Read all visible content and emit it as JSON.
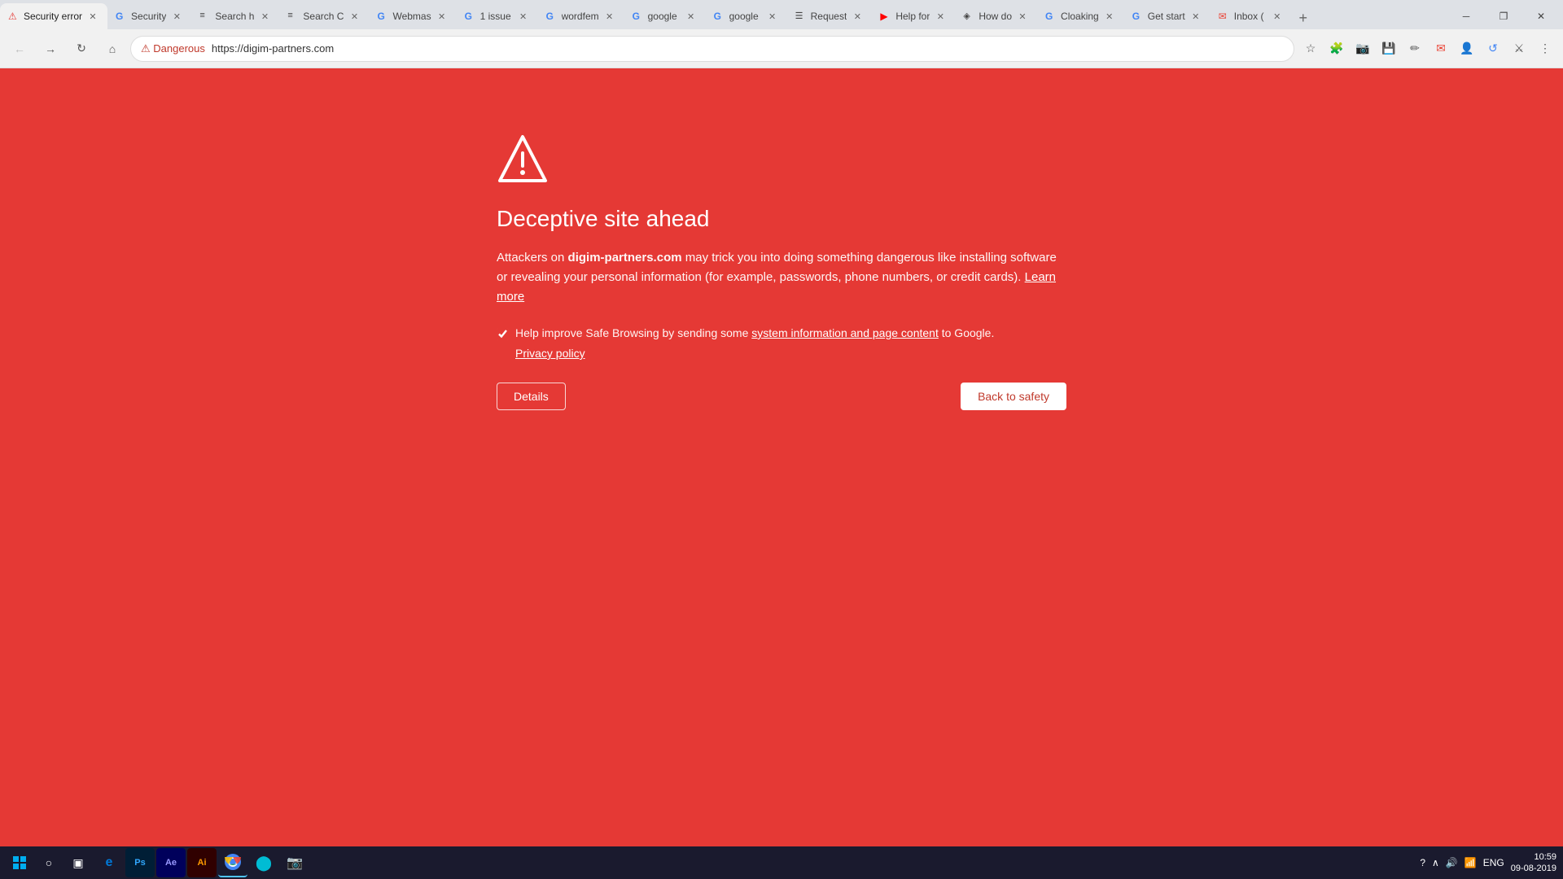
{
  "browser": {
    "tabs": [
      {
        "id": "security-error",
        "label": "Security error",
        "active": true,
        "favicon": "⚠"
      },
      {
        "id": "security",
        "label": "Security",
        "active": false,
        "favicon": "G"
      },
      {
        "id": "search-h",
        "label": "Search h",
        "active": false,
        "favicon": "≡"
      },
      {
        "id": "search-c",
        "label": "Search C",
        "active": false,
        "favicon": "≡"
      },
      {
        "id": "webmaster",
        "label": "Webmas",
        "active": false,
        "favicon": "G"
      },
      {
        "id": "1-issue",
        "label": "1 issue",
        "active": false,
        "favicon": "G"
      },
      {
        "id": "wordfence",
        "label": "wordfem",
        "active": false,
        "favicon": "G"
      },
      {
        "id": "google1",
        "label": "google",
        "active": false,
        "favicon": "G"
      },
      {
        "id": "google2",
        "label": "google",
        "active": false,
        "favicon": "G"
      },
      {
        "id": "request",
        "label": "Request",
        "active": false,
        "favicon": "☰"
      },
      {
        "id": "help-for",
        "label": "Help for",
        "active": false,
        "favicon": "▶"
      },
      {
        "id": "how-do",
        "label": "How do",
        "active": false,
        "favicon": "◈"
      },
      {
        "id": "cloaking",
        "label": "Cloaking",
        "active": false,
        "favicon": "G"
      },
      {
        "id": "get-start",
        "label": "Get start",
        "active": false,
        "favicon": "G"
      },
      {
        "id": "inbox",
        "label": "Inbox (",
        "active": false,
        "favicon": "✉"
      }
    ],
    "url": "https://digim-partners.com",
    "url_display": "https://digim-partners.com",
    "danger_label": "⚠ Dangerous",
    "new_tab": "+",
    "window_controls": {
      "minimize": "─",
      "restore": "❐",
      "close": "✕"
    }
  },
  "page": {
    "title": "Deceptive site ahead",
    "description_before": "Attackers on ",
    "domain": "digim-partners.com",
    "description_after": " may trick you into doing something dangerous like installing software or revealing your personal information (for example, passwords, phone numbers, or credit cards).",
    "learn_more": "Learn more",
    "checkbox_label_before": "Help improve Safe Browsing by sending some ",
    "checkbox_link_text": "system information and page content",
    "checkbox_label_after": " to Google.",
    "privacy_policy": "Privacy policy",
    "details_btn": "Details",
    "back_to_safety_btn": "Back to safety"
  },
  "taskbar": {
    "start_icon": "⊞",
    "search_icon": "○",
    "task_view_icon": "▣",
    "apps": [
      {
        "name": "edge",
        "icon": "e",
        "color": "#0078d7"
      },
      {
        "name": "photoshop",
        "icon": "Ps",
        "color": "#31a8ff"
      },
      {
        "name": "after-effects",
        "icon": "Ae",
        "color": "#9999ff"
      },
      {
        "name": "illustrator",
        "icon": "Ai",
        "color": "#ff9a00"
      },
      {
        "name": "chrome",
        "icon": "⬤",
        "color": "#4285f4"
      },
      {
        "name": "unknown",
        "icon": "⬤",
        "color": "#00bcd4"
      },
      {
        "name": "photos",
        "icon": "📷",
        "color": "#0078d7"
      }
    ],
    "sys_icons": [
      "?",
      "∧",
      "🔊",
      "📶"
    ],
    "language": "ENG",
    "time": "10:59",
    "date": "09-08-2019"
  }
}
